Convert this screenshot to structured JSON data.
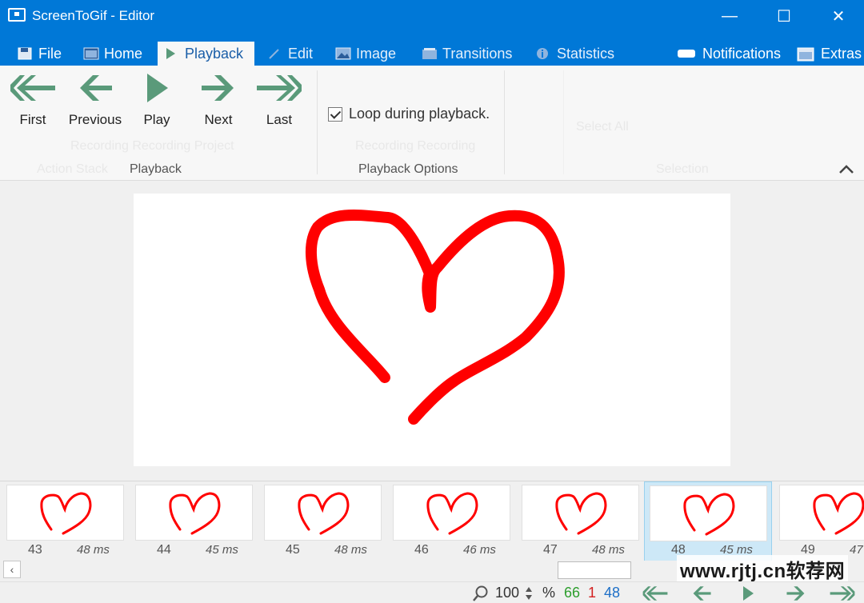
{
  "window": {
    "title": "ScreenToGif - Editor",
    "minimize": "—",
    "maximize": "☐",
    "close": "✕"
  },
  "tabs": [
    {
      "label": "File"
    },
    {
      "label": "Home"
    },
    {
      "label": "Playback"
    },
    {
      "label": "Edit"
    },
    {
      "label": "Image"
    },
    {
      "label": "Transitions"
    },
    {
      "label": "Statistics"
    }
  ],
  "header_right": {
    "notifications": "Notifications",
    "extras": "Extras"
  },
  "ribbon": {
    "playback_buttons": [
      "First",
      "Previous",
      "Play",
      "Next",
      "Last"
    ],
    "playback_group_label": "Playback",
    "loop_label": "Loop during playback.",
    "loop_checked": true,
    "options_group_label": "Playback Options"
  },
  "frames": [
    {
      "number": "43",
      "duration": "48 ms"
    },
    {
      "number": "44",
      "duration": "45 ms"
    },
    {
      "number": "45",
      "duration": "48 ms"
    },
    {
      "number": "46",
      "duration": "46 ms"
    },
    {
      "number": "47",
      "duration": "48 ms"
    },
    {
      "number": "48",
      "duration": "45 ms",
      "selected": true
    },
    {
      "number": "49",
      "duration": "47"
    }
  ],
  "status": {
    "zoom": "100",
    "zoom_unit": "%",
    "total_frames": "66",
    "selected_count": "1",
    "current_frame": "48"
  },
  "watermark": "www.rjtj.cn软荐网",
  "colors": {
    "accent": "#0078d7",
    "stroke": "#ff0000",
    "nav_green": "#5a9a7a",
    "count_green": "#2e9e2e",
    "count_red": "#d32020",
    "count_blue": "#1d6fc7"
  }
}
